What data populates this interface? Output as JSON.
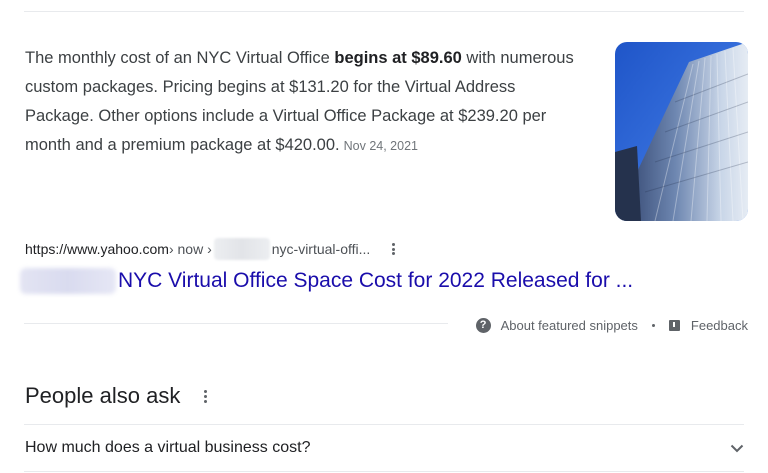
{
  "snippet": {
    "text_before": "The monthly cost of an NYC Virtual Office ",
    "text_bold": "begins at $89.60",
    "text_after": " with numerous custom packages. Pricing begins at $131.20 for the Virtual Address Package. Other options include a Virtual Office Package at $239.20 per month and a premium package at $420.00.",
    "date": "Nov 24, 2021"
  },
  "result": {
    "url_base": "https://www.yahoo.com",
    "url_path1": " › now › ",
    "url_path2": "nyc-virtual-offi...",
    "title": "NYC Virtual Office Space Cost for 2022 Released for ..."
  },
  "feedback": {
    "about_label": "About featured snippets",
    "feedback_label": "Feedback",
    "icons": [
      "help-circle-icon",
      "flag-icon"
    ]
  },
  "people_also_ask": {
    "heading": "People also ask",
    "questions": [
      {
        "text": "How much does a virtual business cost?"
      }
    ]
  },
  "colors": {
    "link": "#1a0dab",
    "text": "#202124",
    "muted": "#70757a"
  }
}
